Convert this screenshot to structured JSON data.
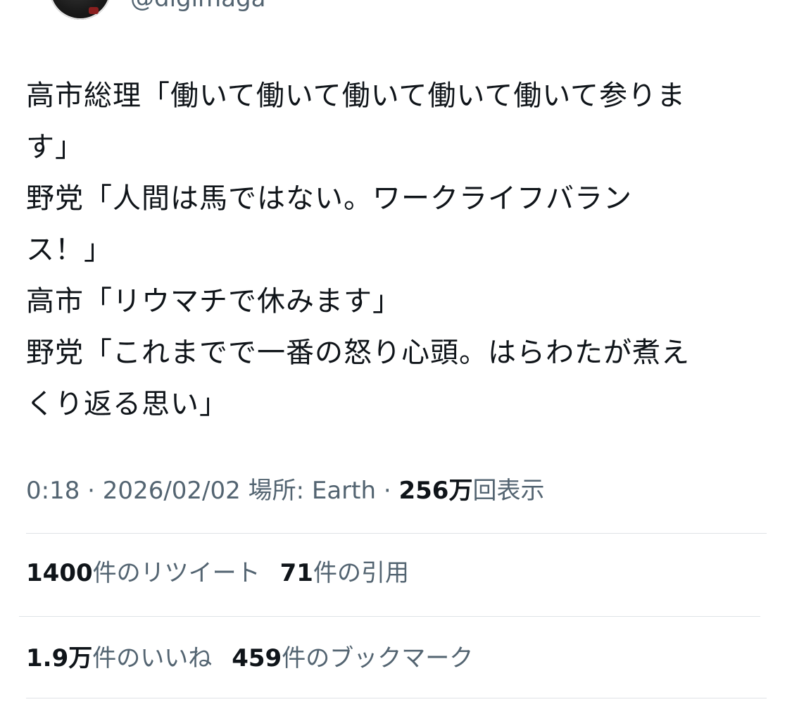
{
  "author": {
    "handle": "@digimaga"
  },
  "tweet": {
    "lines": [
      "高市総理「働いて働いて働いて働いて働いて参りま",
      "す」",
      "野党「人間は馬ではない。ワークライフバラン",
      "ス！」",
      "高市「リウマチで休みます」",
      "野党「これまでで一番の怒り心頭。はらわたが煮え",
      "くり返る思い」"
    ]
  },
  "meta": {
    "time": "0:18",
    "separator": " · ",
    "date": "2026/02/02",
    "location": "場所: Earth",
    "views_count": "256万",
    "views_label": "回表示"
  },
  "stats": {
    "retweets_count": "1400",
    "retweets_label": "件のリツイート",
    "quotes_count": "71",
    "quotes_label": "件の引用",
    "likes_count": "1.9万",
    "likes_label": "件のいいね",
    "bookmarks_count": "459",
    "bookmarks_label": "件のブックマーク"
  },
  "colors": {
    "text_primary": "#0f1419",
    "text_secondary": "#536471",
    "divider": "#dfe3e6"
  }
}
